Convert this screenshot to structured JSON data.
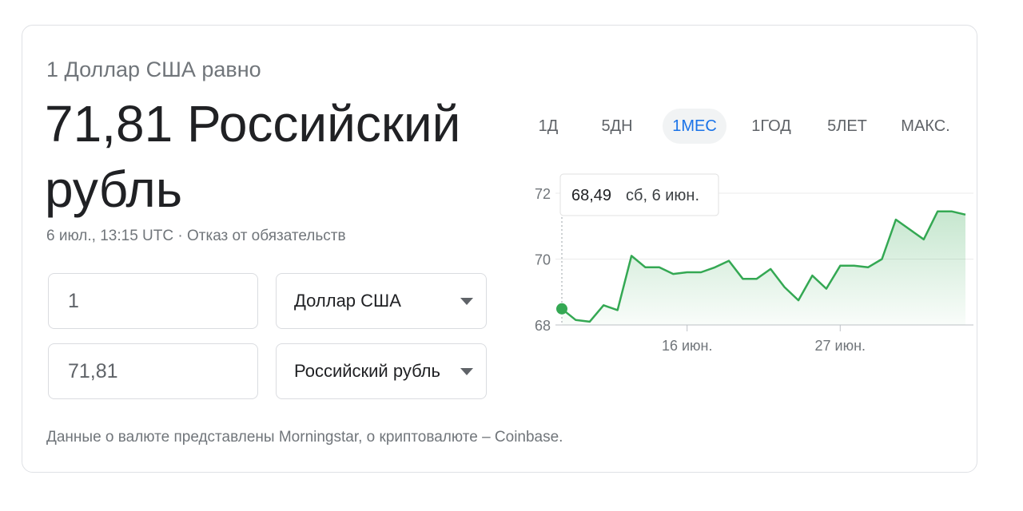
{
  "header": {
    "equals_text": "1 Доллар США равно",
    "result_text": "71,81 Российский рубль",
    "timestamp": "6 июл., 13:15 UTC",
    "separator": "·",
    "disclaimer": "Отказ от обязательств"
  },
  "converter": {
    "amount_from": "1",
    "currency_from": "Доллар США",
    "amount_to": "71,81",
    "currency_to": "Российский рубль"
  },
  "range_tabs": [
    {
      "label": "1Д",
      "active": false
    },
    {
      "label": "5ДН",
      "active": false
    },
    {
      "label": "1МЕС",
      "active": true
    },
    {
      "label": "1ГОД",
      "active": false
    },
    {
      "label": "5ЛЕТ",
      "active": false
    },
    {
      "label": "МАКС.",
      "active": false
    }
  ],
  "footer": {
    "text": "Данные о валюте представлены Morningstar, о криптовалюте – Coinbase."
  },
  "colors": {
    "line": "#34a853",
    "fill": "#34a853",
    "active_tab": "#1a73e8"
  },
  "chart_data": {
    "type": "area",
    "x_tick_labels": [
      "16 июн.",
      "27 июн."
    ],
    "x_tick_indices": [
      9,
      20
    ],
    "yticks": [
      68,
      70,
      72
    ],
    "ylim": [
      68,
      72
    ],
    "grid": true,
    "values": [
      68.49,
      68.15,
      68.1,
      68.6,
      68.45,
      70.1,
      69.75,
      69.75,
      69.55,
      69.6,
      69.6,
      69.75,
      69.95,
      69.4,
      69.4,
      69.7,
      69.15,
      68.75,
      69.5,
      69.1,
      69.8,
      69.8,
      69.75,
      70.0,
      71.2,
      70.9,
      70.6,
      71.45,
      71.45,
      71.35
    ],
    "tooltip": {
      "index": 0,
      "value_text": "68,49",
      "date_text": "сб, 6 июн."
    }
  }
}
